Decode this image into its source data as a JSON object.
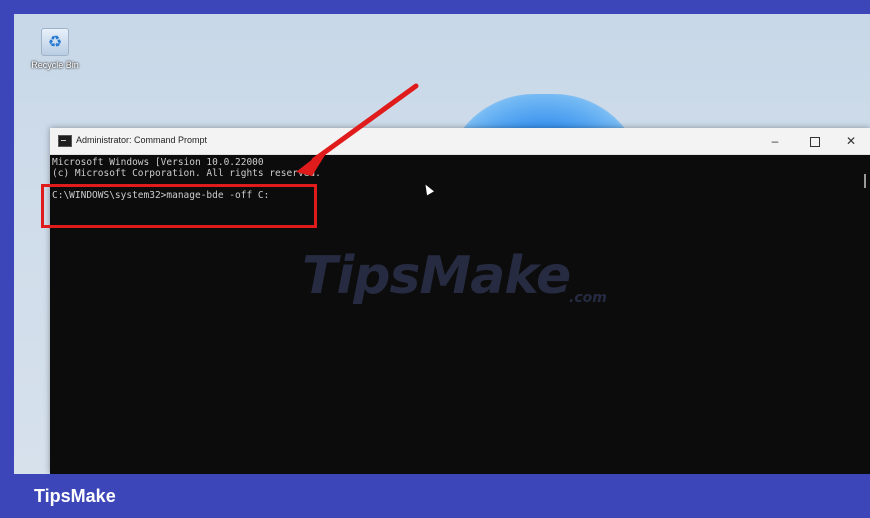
{
  "desktop": {
    "recycle_bin_label": "Recycle Bin"
  },
  "window": {
    "title": "Administrator: Command Prompt",
    "minimize_glyph": "–",
    "close_glyph": "✕"
  },
  "console": {
    "lines": [
      "Microsoft Windows [Version 10.0.22000",
      "(c) Microsoft Corporation. All rights reserved."
    ],
    "prompt_line": "C:\\WINDOWS\\system32>manage-bde -off C:"
  },
  "watermark": {
    "text": "TipsMake",
    "suffix": ".com"
  },
  "footer": {
    "brand": "TipsMake"
  },
  "colors": {
    "frame": "#3d46b8",
    "highlight": "#e01b1b",
    "console_bg": "#0c0c0c"
  }
}
